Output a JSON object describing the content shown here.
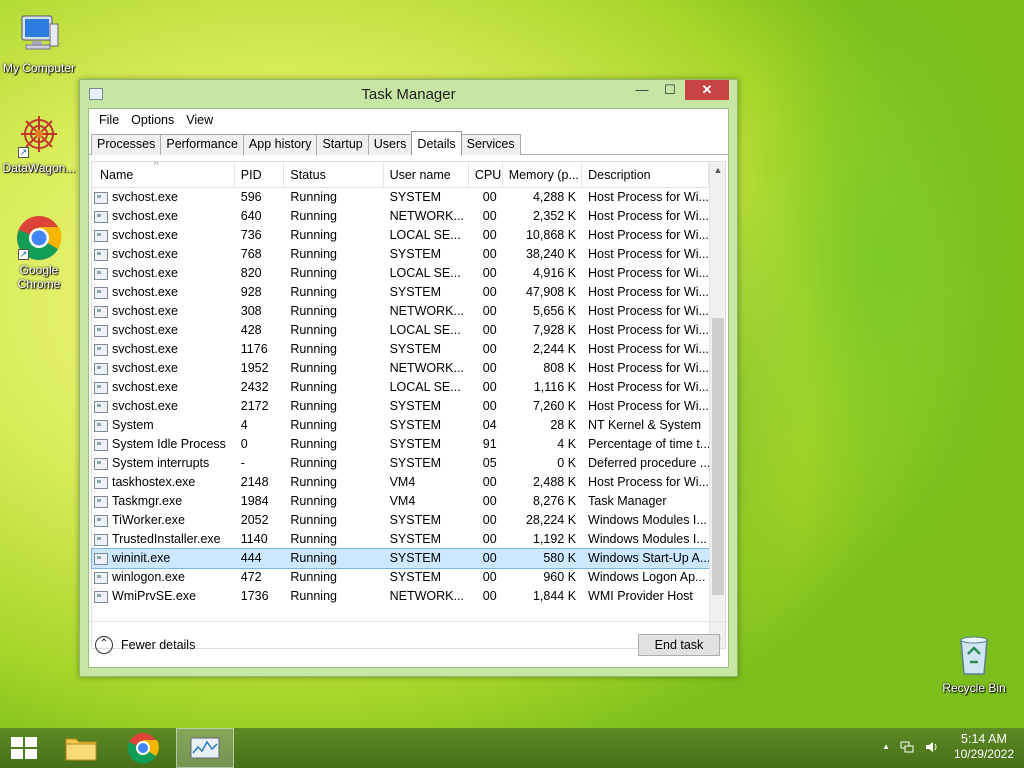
{
  "desktop": {
    "icons": [
      {
        "label": "My Computer"
      },
      {
        "label": "DataWagon..."
      },
      {
        "label": "Google Chrome"
      },
      {
        "label": "Recycle Bin"
      }
    ]
  },
  "window": {
    "title": "Task Manager",
    "controls": {
      "minimize": "—",
      "maximize": "☐",
      "close": "✕"
    },
    "menu": [
      "File",
      "Options",
      "View"
    ],
    "tabs": [
      "Processes",
      "Performance",
      "App history",
      "Startup",
      "Users",
      "Details",
      "Services"
    ],
    "active_tab": "Details",
    "columns": [
      "Name",
      "PID",
      "Status",
      "User name",
      "CPU",
      "Memory (p...",
      "Description"
    ],
    "sort_indicator": "^",
    "rows": [
      {
        "name": "svchost.exe",
        "pid": "596",
        "status": "Running",
        "user": "SYSTEM",
        "cpu": "00",
        "mem": "4,288 K",
        "desc": "Host Process for Wi..."
      },
      {
        "name": "svchost.exe",
        "pid": "640",
        "status": "Running",
        "user": "NETWORK...",
        "cpu": "00",
        "mem": "2,352 K",
        "desc": "Host Process for Wi..."
      },
      {
        "name": "svchost.exe",
        "pid": "736",
        "status": "Running",
        "user": "LOCAL SE...",
        "cpu": "00",
        "mem": "10,868 K",
        "desc": "Host Process for Wi..."
      },
      {
        "name": "svchost.exe",
        "pid": "768",
        "status": "Running",
        "user": "SYSTEM",
        "cpu": "00",
        "mem": "38,240 K",
        "desc": "Host Process for Wi..."
      },
      {
        "name": "svchost.exe",
        "pid": "820",
        "status": "Running",
        "user": "LOCAL SE...",
        "cpu": "00",
        "mem": "4,916 K",
        "desc": "Host Process for Wi..."
      },
      {
        "name": "svchost.exe",
        "pid": "928",
        "status": "Running",
        "user": "SYSTEM",
        "cpu": "00",
        "mem": "47,908 K",
        "desc": "Host Process for Wi..."
      },
      {
        "name": "svchost.exe",
        "pid": "308",
        "status": "Running",
        "user": "NETWORK...",
        "cpu": "00",
        "mem": "5,656 K",
        "desc": "Host Process for Wi..."
      },
      {
        "name": "svchost.exe",
        "pid": "428",
        "status": "Running",
        "user": "LOCAL SE...",
        "cpu": "00",
        "mem": "7,928 K",
        "desc": "Host Process for Wi..."
      },
      {
        "name": "svchost.exe",
        "pid": "1176",
        "status": "Running",
        "user": "SYSTEM",
        "cpu": "00",
        "mem": "2,244 K",
        "desc": "Host Process for Wi..."
      },
      {
        "name": "svchost.exe",
        "pid": "1952",
        "status": "Running",
        "user": "NETWORK...",
        "cpu": "00",
        "mem": "808 K",
        "desc": "Host Process for Wi..."
      },
      {
        "name": "svchost.exe",
        "pid": "2432",
        "status": "Running",
        "user": "LOCAL SE...",
        "cpu": "00",
        "mem": "1,116 K",
        "desc": "Host Process for Wi..."
      },
      {
        "name": "svchost.exe",
        "pid": "2172",
        "status": "Running",
        "user": "SYSTEM",
        "cpu": "00",
        "mem": "7,260 K",
        "desc": "Host Process for Wi..."
      },
      {
        "name": "System",
        "pid": "4",
        "status": "Running",
        "user": "SYSTEM",
        "cpu": "04",
        "mem": "28 K",
        "desc": "NT Kernel & System"
      },
      {
        "name": "System Idle Process",
        "pid": "0",
        "status": "Running",
        "user": "SYSTEM",
        "cpu": "91",
        "mem": "4 K",
        "desc": "Percentage of time t..."
      },
      {
        "name": "System interrupts",
        "pid": "-",
        "status": "Running",
        "user": "SYSTEM",
        "cpu": "05",
        "mem": "0 K",
        "desc": "Deferred procedure ..."
      },
      {
        "name": "taskhostex.exe",
        "pid": "2148",
        "status": "Running",
        "user": "VM4",
        "cpu": "00",
        "mem": "2,488 K",
        "desc": "Host Process for Wi..."
      },
      {
        "name": "Taskmgr.exe",
        "pid": "1984",
        "status": "Running",
        "user": "VM4",
        "cpu": "00",
        "mem": "8,276 K",
        "desc": "Task Manager"
      },
      {
        "name": "TiWorker.exe",
        "pid": "2052",
        "status": "Running",
        "user": "SYSTEM",
        "cpu": "00",
        "mem": "28,224 K",
        "desc": "Windows Modules I..."
      },
      {
        "name": "TrustedInstaller.exe",
        "pid": "1140",
        "status": "Running",
        "user": "SYSTEM",
        "cpu": "00",
        "mem": "1,192 K",
        "desc": "Windows Modules I..."
      },
      {
        "name": "wininit.exe",
        "pid": "444",
        "status": "Running",
        "user": "SYSTEM",
        "cpu": "00",
        "mem": "580 K",
        "desc": "Windows Start-Up A...",
        "selected": true
      },
      {
        "name": "winlogon.exe",
        "pid": "472",
        "status": "Running",
        "user": "SYSTEM",
        "cpu": "00",
        "mem": "960 K",
        "desc": "Windows Logon Ap..."
      },
      {
        "name": "WmiPrvSE.exe",
        "pid": "1736",
        "status": "Running",
        "user": "NETWORK...",
        "cpu": "00",
        "mem": "1,844 K",
        "desc": "WMI Provider Host"
      }
    ],
    "footer": {
      "fewer_details": "Fewer details",
      "end_task": "End task"
    }
  },
  "taskbar": {
    "time": "5:14 AM",
    "date": "10/29/2022",
    "tray_expand": "▲"
  },
  "colors": {
    "selected_row": "#cce8ff",
    "close_button": "#c74444",
    "window_frame": "#c7e6a4"
  }
}
